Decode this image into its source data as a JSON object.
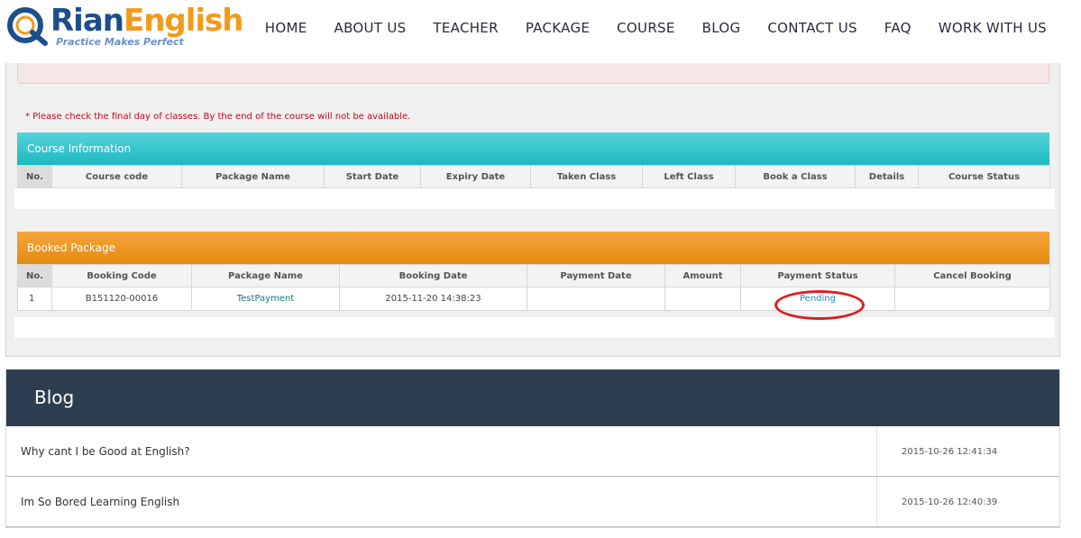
{
  "brand": {
    "name_part1": "Rian",
    "name_part2": "English",
    "tagline": "Practice Makes Perfect",
    "colors": {
      "blue": "#1d4e8c",
      "orange": "#f39a1b"
    }
  },
  "nav": [
    "HOME",
    "ABOUT US",
    "TEACHER",
    "PACKAGE",
    "COURSE",
    "BLOG",
    "CONTACT US",
    "FAQ",
    "WORK WITH US"
  ],
  "notice": "* Please check the final day of classes. By the end of the course will not be available.",
  "course_information": {
    "title": "Course Information",
    "columns": [
      "No.",
      "Course code",
      "Package Name",
      "Start Date",
      "Expiry Date",
      "Taken Class",
      "Left Class",
      "Book a Class",
      "Details",
      "Course Status"
    ],
    "rows": []
  },
  "booked_package": {
    "title": "Booked Package",
    "columns": [
      "No.",
      "Booking Code",
      "Package Name",
      "Booking Date",
      "Payment Date",
      "Amount",
      "Payment Status",
      "Cancel Booking"
    ],
    "rows": [
      {
        "no": "1",
        "booking_code": "B151120-00016",
        "package_name": "TestPayment",
        "booking_date": "2015-11-20 14:38:23",
        "payment_date": "",
        "amount": "",
        "payment_status": "Pending",
        "cancel_booking": ""
      }
    ]
  },
  "blog": {
    "title": "Blog",
    "posts": [
      {
        "title": "Why cant I be Good at English?",
        "date": "2015-10-26 12:41:34"
      },
      {
        "title": "Im So Bored Learning English",
        "date": "2015-10-26 12:40:39"
      }
    ]
  }
}
